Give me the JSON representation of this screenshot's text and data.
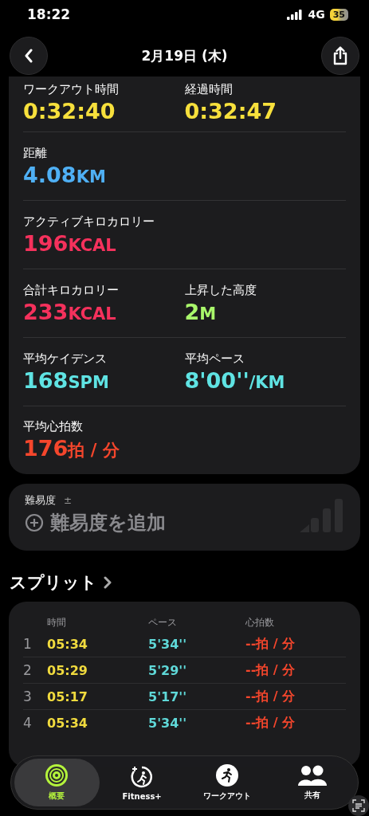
{
  "status_bar": {
    "time": "18:22",
    "network": "4G",
    "battery": "35"
  },
  "header": {
    "title": "2月19日 (木)"
  },
  "metric_rows": [
    [
      {
        "label": "ワークアウト時間",
        "value": "0:32:40",
        "color": "#f7e03c"
      },
      {
        "label": "経過時間",
        "value": "0:32:47",
        "color": "#f7e03c"
      }
    ],
    [
      {
        "label": "距離",
        "value": "4.08",
        "unit": "KM",
        "color": "#4fb0f5"
      }
    ],
    [
      {
        "label": "アクティブキロカロリー",
        "value": "196",
        "unit": "KCAL",
        "color": "#f5315c"
      }
    ],
    [
      {
        "label": "合計キロカロリー",
        "value": "233",
        "unit": "KCAL",
        "color": "#f5315c"
      },
      {
        "label": "上昇した高度",
        "value": "2",
        "unit": "M",
        "color": "#a9f76b"
      }
    ],
    [
      {
        "label": "平均ケイデンス",
        "value": "168",
        "unit": "SPM",
        "color": "#5fe3e3"
      },
      {
        "label": "平均ペース",
        "value": "8'00''",
        "unit": "/KM",
        "color": "#5fe3e3"
      }
    ],
    [
      {
        "label": "平均心拍数",
        "value": "176",
        "unit": "拍 / 分",
        "color": "#f5462c"
      }
    ]
  ],
  "difficulty": {
    "label": "難易度",
    "sign": "±",
    "action": "難易度を追加"
  },
  "splits": {
    "title": "スプリット",
    "columns": [
      "時間",
      "ペース",
      "心拍数"
    ],
    "rows": [
      {
        "index": "1",
        "time": "05:34",
        "pace": "5'34''",
        "heart_rate": "--拍 / 分"
      },
      {
        "index": "2",
        "time": "05:29",
        "pace": "5'29''",
        "heart_rate": "--拍 / 分"
      },
      {
        "index": "3",
        "time": "05:17",
        "pace": "5'17''",
        "heart_rate": "--拍 / 分"
      },
      {
        "index": "4",
        "time": "05:34",
        "pace": "5'34''",
        "heart_rate": "--拍 / 分"
      }
    ]
  },
  "tab_bar": [
    {
      "label": "概要",
      "kind": "summary",
      "selected": true
    },
    {
      "label": "Fitness+",
      "kind": "fitness",
      "selected": false
    },
    {
      "label": "ワークアウト",
      "kind": "workout",
      "selected": false
    },
    {
      "label": "共有",
      "kind": "sharing",
      "selected": false
    }
  ]
}
